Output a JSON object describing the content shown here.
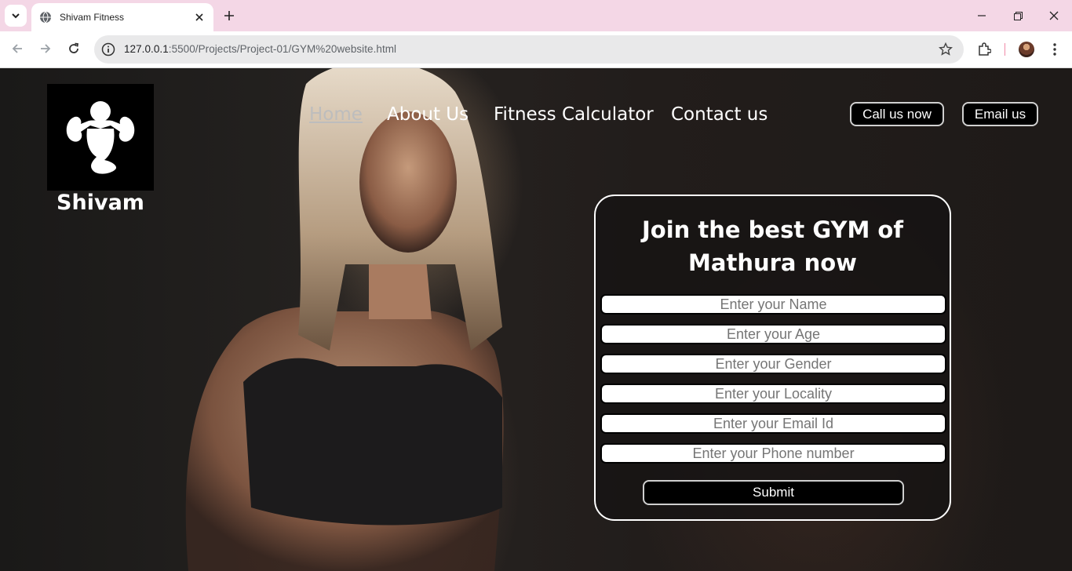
{
  "browser": {
    "tab_title": "Shivam Fitness",
    "url_host": "127.0.0.1",
    "url_rest": ":5500/Projects/Project-01/GYM%20website.html"
  },
  "site": {
    "logo_text": "Shivam",
    "nav": [
      "Home",
      "About Us",
      "Fitness Calculator",
      "Contact us"
    ],
    "call_button": "Call us now",
    "email_button": "Email us"
  },
  "form": {
    "title": "Join the best GYM of Mathura now",
    "fields": [
      {
        "placeholder": "Enter your Name"
      },
      {
        "placeholder": "Enter your Age"
      },
      {
        "placeholder": "Enter your Gender"
      },
      {
        "placeholder": "Enter your Locality"
      },
      {
        "placeholder": "Enter your Email Id"
      },
      {
        "placeholder": "Enter your Phone number"
      }
    ],
    "submit": "Submit"
  },
  "colors": {
    "tabstrip": "#f4d7e6",
    "page_bg": "#1b1a19",
    "accent": "#ffffff"
  }
}
